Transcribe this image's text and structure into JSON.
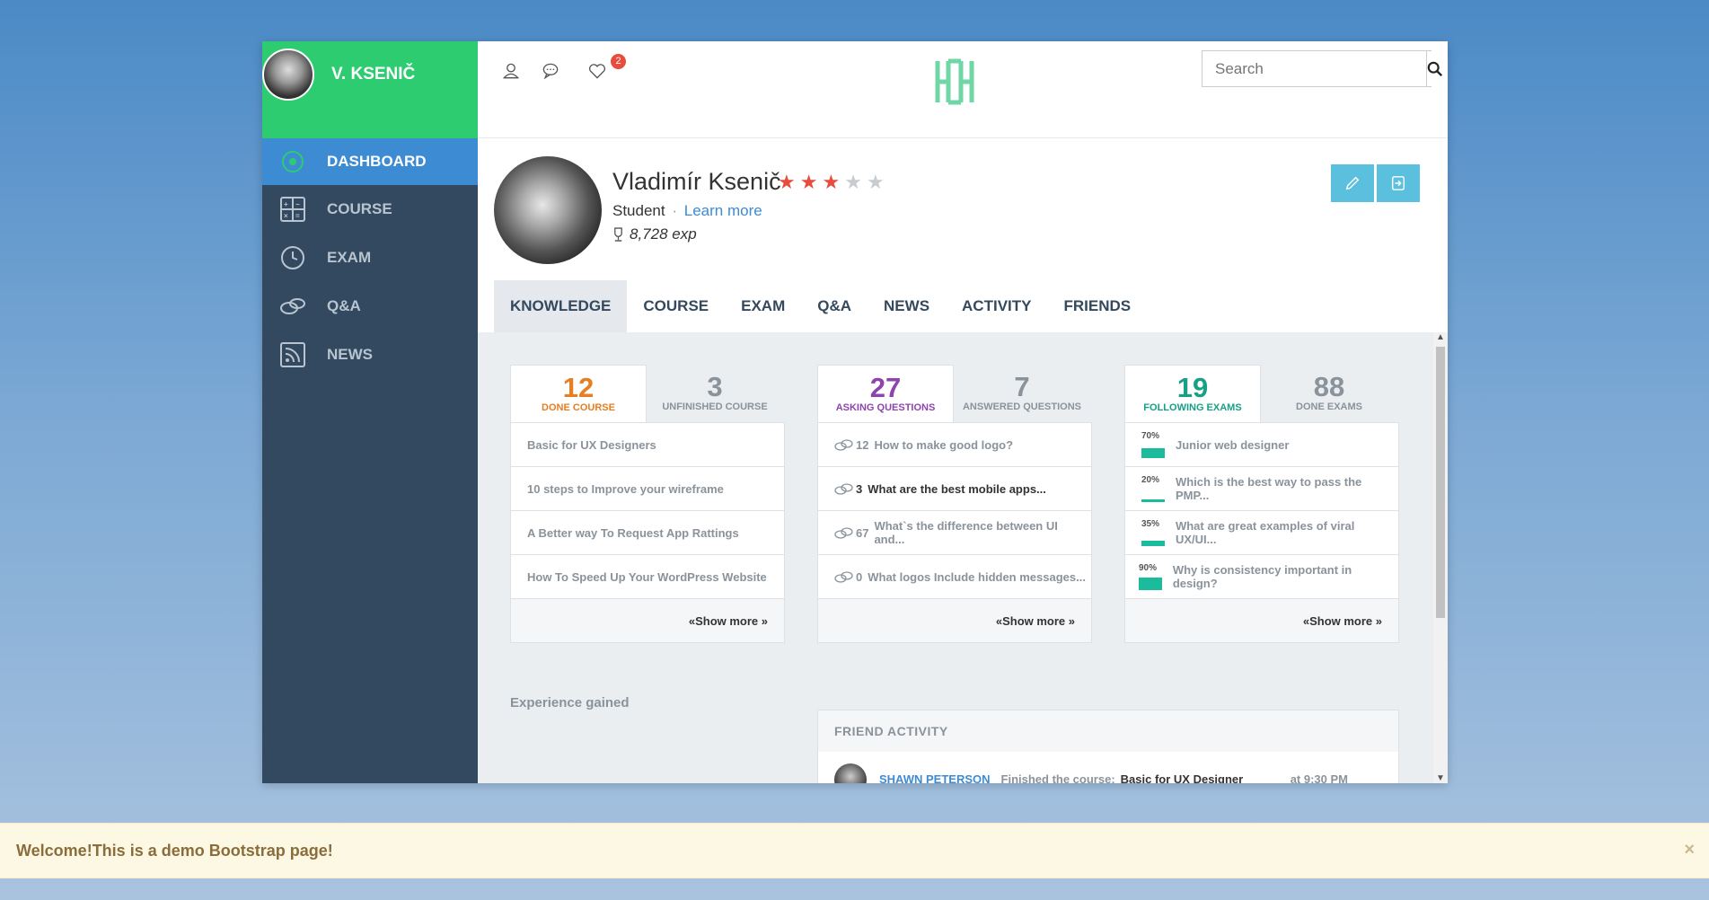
{
  "sidebar": {
    "user_name": "V. KSENIČ",
    "items": [
      {
        "label": "DASHBOARD",
        "icon": "target-icon",
        "active": true
      },
      {
        "label": "COURSE",
        "icon": "calculator-icon",
        "active": false
      },
      {
        "label": "EXAM",
        "icon": "clock-icon",
        "active": false
      },
      {
        "label": "Q&A",
        "icon": "chat-icon",
        "active": false
      },
      {
        "label": "NEWS",
        "icon": "rss-icon",
        "active": false
      }
    ]
  },
  "header": {
    "notification_count": "2",
    "search_placeholder": "Search"
  },
  "profile": {
    "name": "Vladimír Ksenič",
    "rating": 3,
    "rating_max": 5,
    "role": "Student",
    "separator": "·",
    "learn_more": "Learn more",
    "exp": "8,728 exp",
    "tabs": [
      "KNOWLEDGE",
      "COURSE",
      "EXAM",
      "Q&A",
      "NEWS",
      "ACTIVITY",
      "FRIENDS"
    ]
  },
  "courses": {
    "tab_active": {
      "num": "12",
      "label": "DONE COURSE",
      "color": "#e67e22"
    },
    "tab_other": {
      "num": "3",
      "label": "UNFINISHED COURSE"
    },
    "items": [
      "Basic for UX Designers",
      "10 steps to Improve your wireframe",
      "A Better way To Request App Rattings",
      "How To Speed Up Your WordPress Website"
    ],
    "show_more": "«Show more »"
  },
  "questions": {
    "tab_active": {
      "num": "27",
      "label": "ASKING QUESTIONS",
      "color": "#8e44ad"
    },
    "tab_other": {
      "num": "7",
      "label": "ANSWERED QUESTIONS"
    },
    "items": [
      {
        "count": "12",
        "text": "How to make good logo?"
      },
      {
        "count": "3",
        "text": "What are the best mobile apps..."
      },
      {
        "count": "67",
        "text": "What`s the difference between UI and..."
      },
      {
        "count": "0",
        "text": "What logos Include hidden messages..."
      }
    ],
    "show_more": "«Show more »"
  },
  "exams": {
    "tab_active": {
      "num": "19",
      "label": "FOLLOWING EXAMS",
      "color": "#16a085"
    },
    "tab_other": {
      "num": "88",
      "label": "DONE EXAMS"
    },
    "items": [
      {
        "pct": "70%",
        "fill": 0.7,
        "text": "Junior web designer"
      },
      {
        "pct": "20%",
        "fill": 0.2,
        "text": "Which is the best way to pass the PMP..."
      },
      {
        "pct": "35%",
        "fill": 0.35,
        "text": "What are great examples of viral UX/UI..."
      },
      {
        "pct": "90%",
        "fill": 0.9,
        "text": "Why is consistency important in design?"
      }
    ],
    "show_more": "«Show more »"
  },
  "experience": {
    "title": "Experience gained"
  },
  "friend_activity": {
    "title": "FRIEND  ACTIVITY",
    "rows": [
      {
        "user": "SHAWN PETERSON",
        "action": "Finished the course:",
        "target": "Basic for UX Designer",
        "time": "at 9:30 PM"
      }
    ]
  },
  "alert": {
    "text": "Welcome!This is a demo Bootstrap page!",
    "close": "×"
  }
}
